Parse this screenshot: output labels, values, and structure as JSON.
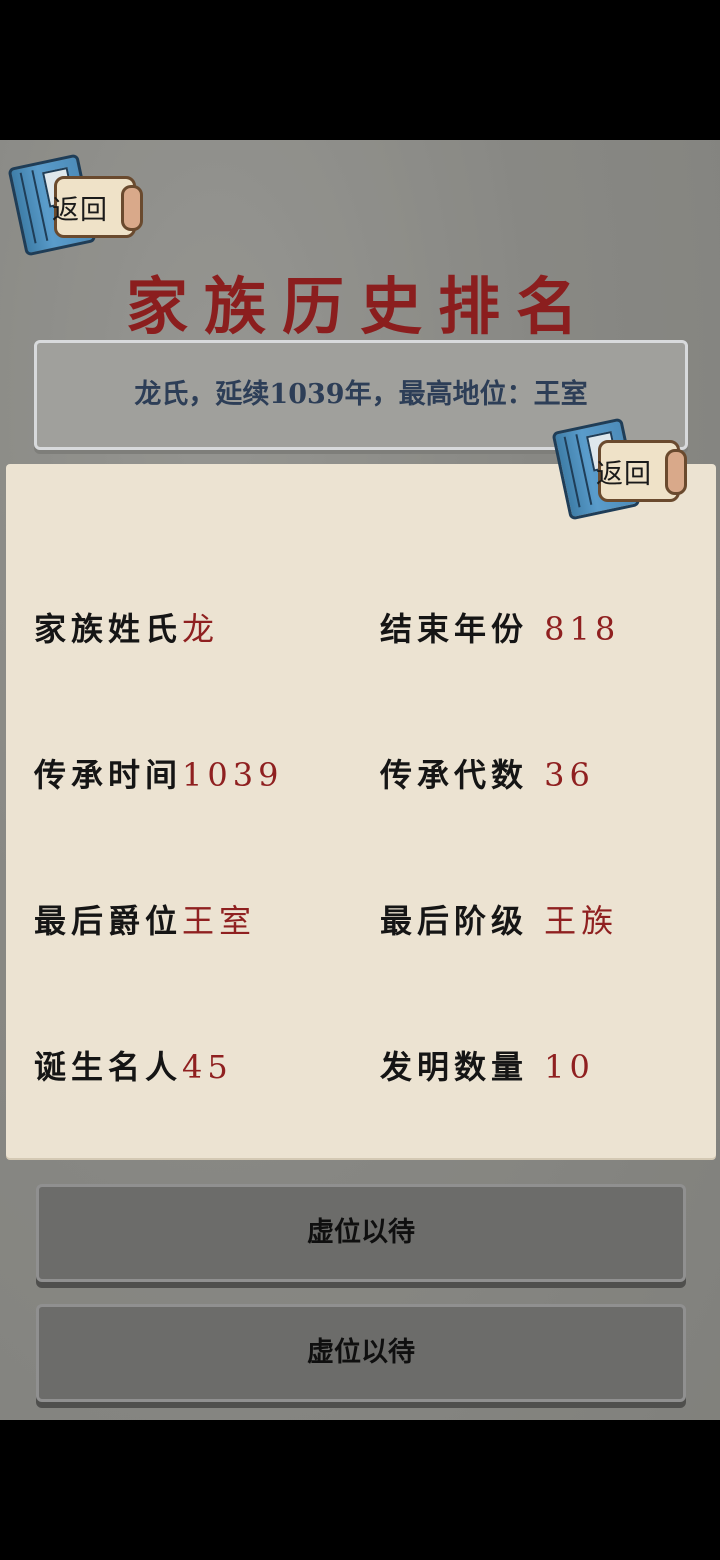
{
  "header": {
    "back_label": "返回",
    "title": "家族历史排名"
  },
  "banner": {
    "text": "龙氏，延续1039年，最高地位：王室"
  },
  "card": {
    "back_label": "返回",
    "stats": [
      {
        "label": "家族姓氏",
        "value": "龙"
      },
      {
        "label": "结束年份",
        "value": "818"
      },
      {
        "label": "传承时间",
        "value": "1039"
      },
      {
        "label": "传承代数",
        "value": "36"
      },
      {
        "label": "最后爵位",
        "value": "王室"
      },
      {
        "label": "最后阶级",
        "value": "王族"
      },
      {
        "label": "诞生名人",
        "value": "45"
      },
      {
        "label": "发明数量",
        "value": "10"
      }
    ]
  },
  "slots": [
    {
      "text": "虚位以待"
    },
    {
      "text": "虚位以待"
    }
  ],
  "colors": {
    "title": "#8b1e1e",
    "value": "#8f2020",
    "banner_text": "#2d3e57",
    "card_bg": "#ece3d2"
  }
}
